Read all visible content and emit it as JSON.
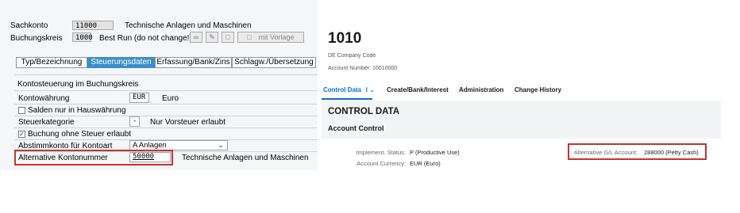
{
  "sap": {
    "fields": {
      "sachkonto_label": "Sachkonto",
      "sachkonto_value": "11000",
      "sachkonto_desc": "Technische Anlagen und Maschinen",
      "buchungskreis_label": "Buchungskreis",
      "buchungskreis_value": "1000",
      "buchungskreis_desc": "Best Run (do not change!)",
      "mit_vorlage_label": "mit Vorlage"
    },
    "tabs": [
      {
        "label": "Typ/Bezeichnung"
      },
      {
        "label": "Steuerungsdaten"
      },
      {
        "label": "Erfassung/Bank/Zins"
      },
      {
        "label": "Schlagw./Übersetzung"
      }
    ],
    "active_tab": "Steuerungsdaten",
    "section_title": "Kontosteuerung im Buchungskreis",
    "rows": {
      "kontowaehrung_label": "Kontowährung",
      "kontowaehrung_value": "EUR",
      "kontowaehrung_desc": "Euro",
      "salden_label": "Salden nur in Hauswährung",
      "steuerkategorie_label": "Steuerkategorie",
      "steuerkategorie_value": "-",
      "steuerkategorie_desc": "Nur Vorsteuer erlaubt",
      "buchung_label": "Buchung ohne Steuer erlaubt",
      "abstimmkonto_label": "Abstimmkonto für Kontoart",
      "abstimmkonto_value": "A Anlagen",
      "alt_konto_label": "Alternative Kontonummer",
      "alt_konto_value": "50000",
      "alt_konto_desc": "Technische Anlagen und Maschinen"
    },
    "checkbox_states": {
      "salden": false,
      "buchung": true
    },
    "icons": [
      "glasses-icon",
      "pencil-icon",
      "document-icon",
      "document-template-icon",
      "dropdown-chevron-icon",
      "checkmark-icon"
    ]
  },
  "fiori": {
    "title": "1010",
    "subtitle": "DE Company Code",
    "account_number_text": "Account Number: 10010000",
    "tabs": [
      {
        "label": "Control Data"
      },
      {
        "label": "Create/Bank/Interest"
      },
      {
        "label": "Administration"
      },
      {
        "label": "Change History"
      }
    ],
    "active_tab_suffix": "⁝ ⌄",
    "section_title": "CONTROL DATA",
    "subsection_title": "Account Control",
    "fields": {
      "implement_status_label": "Implement. Status:",
      "implement_status_value": "P (Productive Use)",
      "account_currency_label": "Account Currency:",
      "account_currency_value": "EUR (Euro)",
      "alt_gl_label": "Alternative G/L Account:",
      "alt_gl_value": "288000 (Petty Cash)"
    }
  },
  "colors": {
    "highlight": "#c9322b",
    "sap_active_tab": "#3c8ec9",
    "fiori_accent": "#0a6ed1"
  }
}
